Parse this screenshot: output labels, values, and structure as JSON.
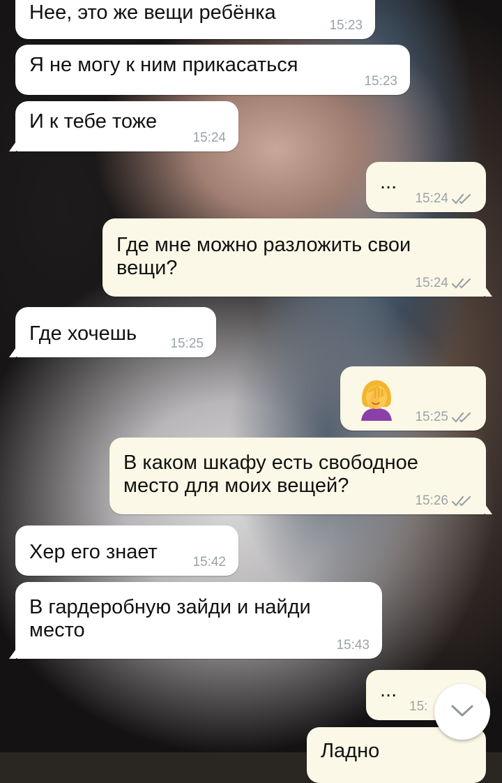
{
  "chat": {
    "messages": [
      {
        "dir": "in",
        "text": "Нее, это же вещи ребёнка",
        "time": "15:23"
      },
      {
        "dir": "in",
        "text": "Я не могу к ним прикасаться",
        "time": "15:23"
      },
      {
        "dir": "in",
        "text": "И к тебе тоже",
        "time": "15:24"
      },
      {
        "dir": "out",
        "text": "...",
        "time": "15:24",
        "status": "read"
      },
      {
        "dir": "out",
        "text": "Где мне можно разложить свои вещи?",
        "time": "15:24",
        "status": "read"
      },
      {
        "dir": "in",
        "text": "Где хочешь",
        "time": "15:25"
      },
      {
        "dir": "out",
        "emoji": "woman-facepalming",
        "time": "15:25",
        "status": "read"
      },
      {
        "dir": "out",
        "text": "В каком шкафу есть свободное место для моих вещей?",
        "time": "15:26",
        "status": "read"
      },
      {
        "dir": "in",
        "text": "Хер его знает",
        "time": "15:42"
      },
      {
        "dir": "in",
        "text": "В гардеробную зайди и найди место",
        "time": "15:43"
      },
      {
        "dir": "out",
        "text": "...",
        "time": "15:",
        "status": "read"
      },
      {
        "dir": "out",
        "text": "Ладно",
        "status": "read"
      }
    ]
  },
  "colors": {
    "incoming_bubble": "#ffffff",
    "outgoing_bubble": "#fcf8e7",
    "time_text": "#9aa3a8",
    "read_checks": "#9aa3a8"
  },
  "icons": {
    "read_status": "double-check-icon",
    "scroll_down": "chevron-down-icon"
  }
}
